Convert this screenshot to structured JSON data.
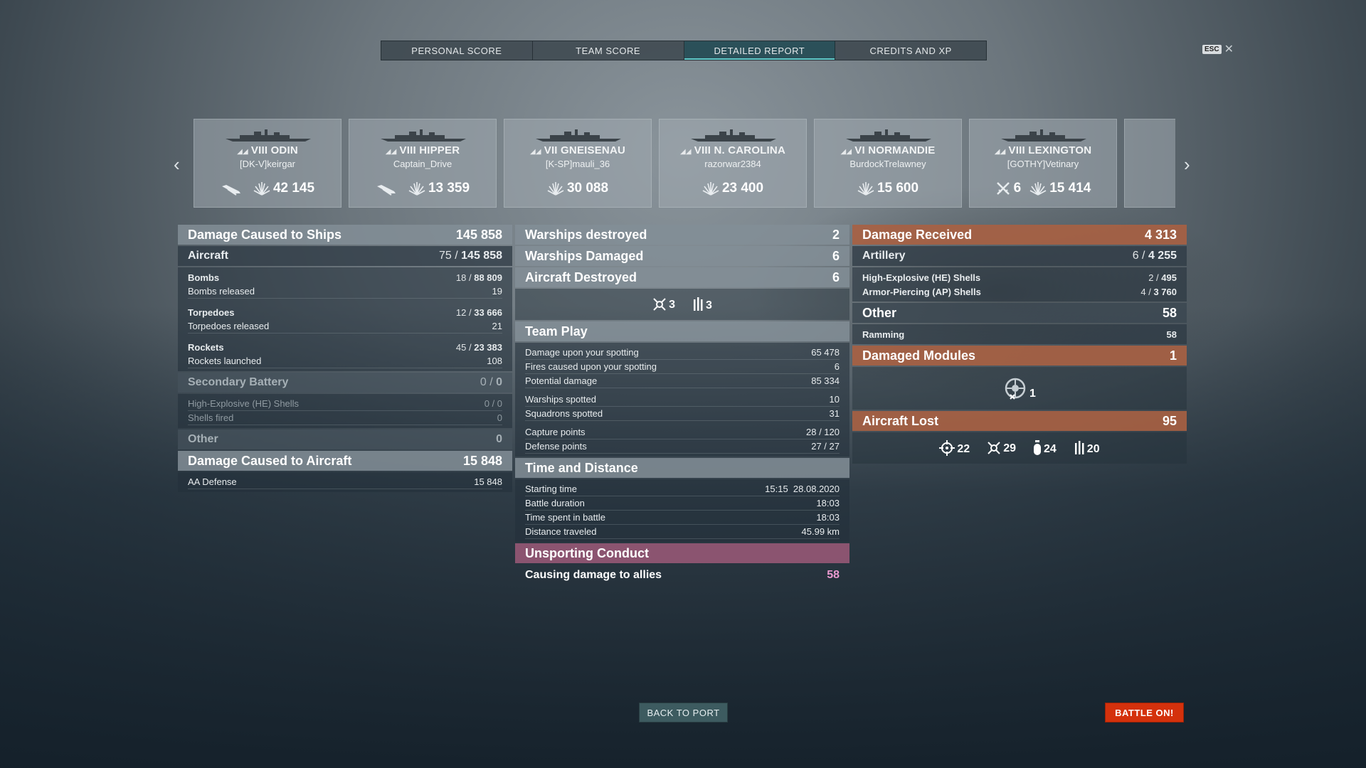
{
  "tabs": [
    "PERSONAL SCORE",
    "TEAM SCORE",
    "DETAILED REPORT",
    "CREDITS AND XP"
  ],
  "esc_label": "ESC",
  "ships": [
    {
      "tier_name": "VIII ODIN",
      "player": "[DK-V]keirgar",
      "stats": [
        {
          "icon": "plane-icon",
          "value": ""
        },
        {
          "icon": "damage-burst-icon",
          "value": "42 145"
        }
      ]
    },
    {
      "tier_name": "VIII HIPPER",
      "player": "Captain_Drive",
      "stats": [
        {
          "icon": "plane-icon",
          "value": ""
        },
        {
          "icon": "damage-burst-icon",
          "value": "13 359"
        }
      ]
    },
    {
      "tier_name": "VII GNEISENAU",
      "player": "[K-SP]mauli_36",
      "stats": [
        {
          "icon": "damage-burst-icon",
          "value": "30 088"
        }
      ]
    },
    {
      "tier_name": "VIII N. CAROLINA",
      "player": "razorwar2384",
      "stats": [
        {
          "icon": "damage-burst-icon",
          "value": "23 400"
        }
      ]
    },
    {
      "tier_name": "VI NORMANDIE",
      "player": "BurdockTrelawney",
      "stats": [
        {
          "icon": "damage-burst-icon",
          "value": "15 600"
        }
      ]
    },
    {
      "tier_name": "VIII LEXINGTON",
      "player": "[GOTHY]Vetinary",
      "stats": [
        {
          "icon": "crossed-swords-icon",
          "value": "6"
        },
        {
          "icon": "damage-burst-icon",
          "value": "15 414"
        }
      ]
    }
  ],
  "left": {
    "damage_ships": {
      "label": "Damage Caused to Ships",
      "value": "145 858"
    },
    "aircraft": {
      "label": "Aircraft",
      "count": "75 /",
      "value": "145 858"
    },
    "bombs": {
      "label": "Bombs",
      "count": "18 /",
      "value": "88 809"
    },
    "bombs_released": {
      "label": "Bombs released",
      "value": "19"
    },
    "torpedoes": {
      "label": "Torpedoes",
      "count": "12 /",
      "value": "33 666"
    },
    "torpedoes_released": {
      "label": "Torpedoes released",
      "value": "21"
    },
    "rockets": {
      "label": "Rockets",
      "count": "45 /",
      "value": "23 383"
    },
    "rockets_launched": {
      "label": "Rockets launched",
      "value": "108"
    },
    "secondary": {
      "label": "Secondary Battery",
      "count": "0 /",
      "value": "0"
    },
    "sec_he": {
      "label": "High-Explosive (HE) Shells",
      "value": "0 / 0"
    },
    "sec_fired": {
      "label": "Shells fired",
      "value": "0"
    },
    "other": {
      "label": "Other",
      "value": "0"
    },
    "damage_aircraft": {
      "label": "Damage Caused to Aircraft",
      "value": "15 848"
    },
    "aa_defense": {
      "label": "AA Defense",
      "value": "15 848"
    }
  },
  "mid": {
    "destroyed": {
      "label": "Warships destroyed",
      "value": "2"
    },
    "damaged": {
      "label": "Warships Damaged",
      "value": "6"
    },
    "aircraft_destroyed": {
      "label": "Aircraft Destroyed",
      "value": "6"
    },
    "aircraft_icons": [
      {
        "icon": "fighter-icon",
        "value": "3"
      },
      {
        "icon": "torpedo-bomber-icon",
        "value": "3"
      }
    ],
    "team_play": {
      "label": "Team Play"
    },
    "spotting_damage": {
      "label": "Damage upon your spotting",
      "value": "65 478"
    },
    "spotting_fires": {
      "label": "Fires caused upon your spotting",
      "value": "6"
    },
    "potential": {
      "label": "Potential damage",
      "value": "85 334"
    },
    "warships_spotted": {
      "label": "Warships spotted",
      "value": "10"
    },
    "squadrons_spotted": {
      "label": "Squadrons spotted",
      "value": "31"
    },
    "capture": {
      "label": "Capture points",
      "value": "28 / 120"
    },
    "defense": {
      "label": "Defense points",
      "value": "27 / 27"
    },
    "time_distance": {
      "label": "Time and Distance"
    },
    "start_time": {
      "label": "Starting time",
      "value": "15:15  28.08.2020"
    },
    "duration": {
      "label": "Battle duration",
      "value": "18:03"
    },
    "time_spent": {
      "label": "Time spent in battle",
      "value": "18:03"
    },
    "distance": {
      "label": "Distance traveled",
      "value": "45.99 km"
    },
    "unsporting": {
      "label": "Unsporting Conduct"
    },
    "allies_damage": {
      "label": "Causing damage to allies",
      "value": "58"
    }
  },
  "right": {
    "received": {
      "label": "Damage Received",
      "value": "4 313"
    },
    "artillery": {
      "label": "Artillery",
      "count": "6 /",
      "value": "4 255"
    },
    "he": {
      "label": "High-Explosive (HE) Shells",
      "count": "2 /",
      "value": "495"
    },
    "ap": {
      "label": "Armor-Piercing (AP) Shells",
      "count": "4 /",
      "value": "3 760"
    },
    "other": {
      "label": "Other",
      "value": "58"
    },
    "ramming": {
      "label": "Ramming",
      "value": "58"
    },
    "modules": {
      "label": "Damaged Modules",
      "value": "1"
    },
    "module_icon_value": "1",
    "aircraft_lost": {
      "label": "Aircraft Lost",
      "value": "95"
    },
    "lost_icons": [
      {
        "icon": "crosshair-icon",
        "value": "22"
      },
      {
        "icon": "fighter-icon",
        "value": "29"
      },
      {
        "icon": "bomb-icon",
        "value": "24"
      },
      {
        "icon": "torpedo-bomber-icon",
        "value": "20"
      }
    ]
  },
  "buttons": {
    "back": "BACK TO PORT",
    "battle": "BATTLE ON!"
  }
}
